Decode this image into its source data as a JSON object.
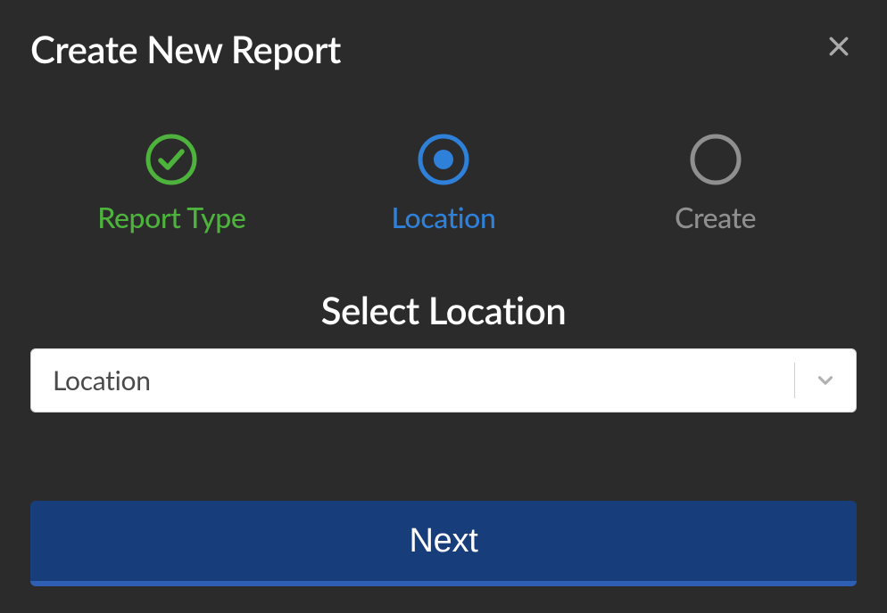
{
  "header": {
    "title": "Create New Report"
  },
  "stepper": {
    "steps": [
      {
        "label": "Report Type",
        "state": "completed"
      },
      {
        "label": "Location",
        "state": "active"
      },
      {
        "label": "Create",
        "state": "pending"
      }
    ]
  },
  "main": {
    "section_title": "Select Location",
    "location_select": {
      "placeholder": "Location",
      "value": ""
    }
  },
  "footer": {
    "next_label": "Next"
  },
  "colors": {
    "completed": "#4db33d",
    "active": "#2f80d8",
    "pending": "#8f8f8f",
    "primary_button": "#173d7a"
  }
}
